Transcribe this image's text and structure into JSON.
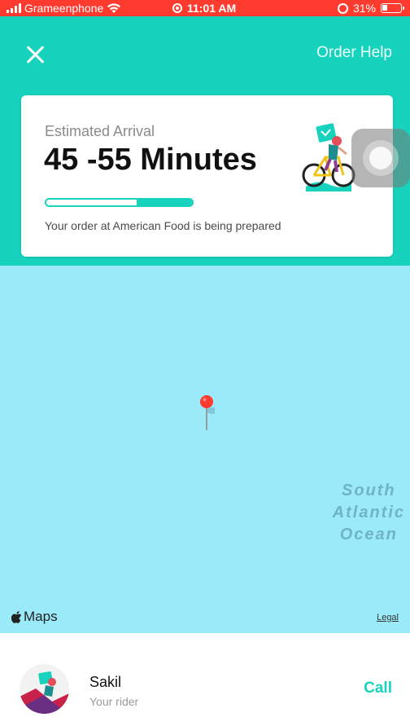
{
  "status_bar": {
    "carrier": "Grameenphone",
    "time": "11:01 AM",
    "battery": "31%"
  },
  "header": {
    "close_icon": "close-icon",
    "order_help": "Order Help",
    "bg_color": "#17d3bd"
  },
  "order_card": {
    "eta_label": "Estimated Arrival",
    "eta_value": "45 -55 Minutes",
    "progress": 0.62,
    "status_text": "Your order at American Food is being prepared"
  },
  "map": {
    "ocean_label_lines": [
      "South",
      "Atlantic",
      "Ocean"
    ],
    "maps_brand": "Maps",
    "legal": "Legal",
    "pin_icon": "map-pin-icon"
  },
  "rider": {
    "name": "Sakil",
    "role": "Your rider",
    "call_label": "Call",
    "accent_color": "#17d3bd"
  }
}
